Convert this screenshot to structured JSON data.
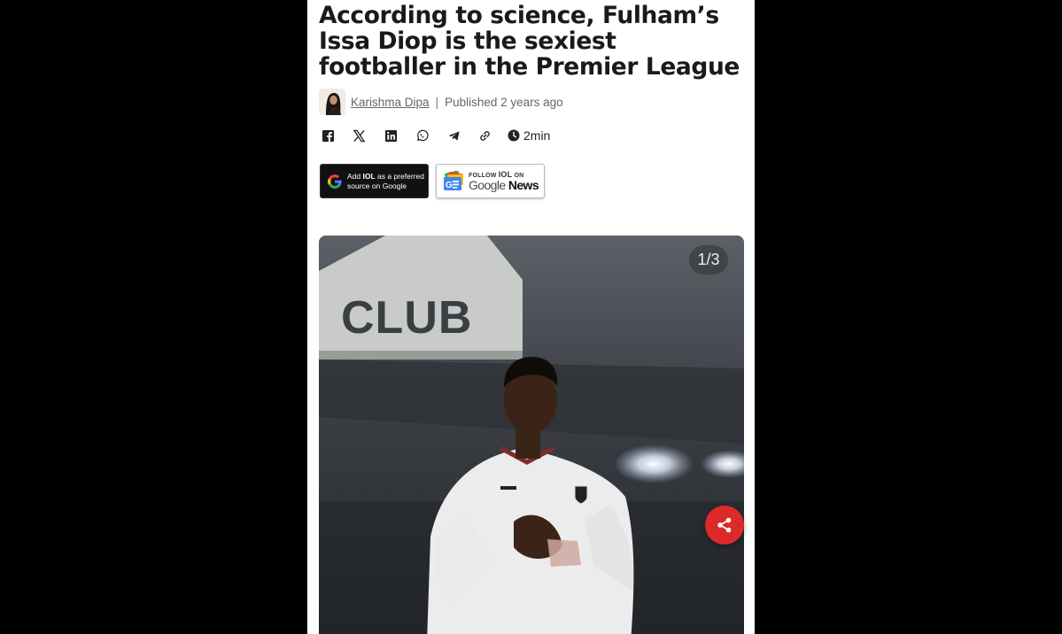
{
  "article": {
    "headline": "According to science, Fulham’s Issa Diop is the sexiest footballer in the Premier League",
    "author": "Karishma Dipa",
    "separator": "|",
    "published": "Published 2 years ago",
    "read_time": "2min"
  },
  "share_icons": [
    "facebook-icon",
    "x-icon",
    "linkedin-icon",
    "whatsapp-icon",
    "telegram-icon",
    "link-icon"
  ],
  "badges": {
    "preferred_source": {
      "add": "Add",
      "brand": "IOL",
      "rest": "as a preferred",
      "line2": "source on Google"
    },
    "google_news": {
      "follow": "FOLLOW",
      "brand": "IOL",
      "on": "ON",
      "google": "Google",
      "news": "News"
    }
  },
  "gallery": {
    "counter": "1/3",
    "image_sign_text": "CLUB"
  },
  "colors": {
    "accent_red": "#dc2a2a",
    "headline": "#1a1a1a",
    "meta_gray": "#666666"
  }
}
